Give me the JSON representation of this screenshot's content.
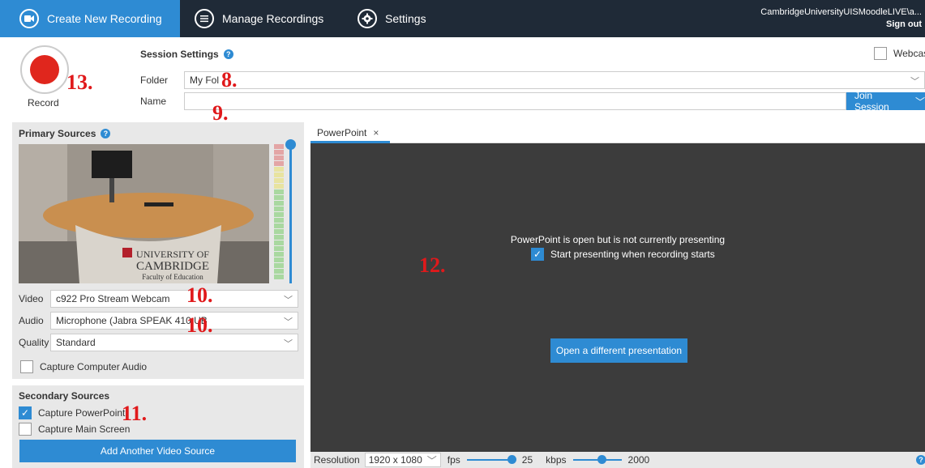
{
  "nav": {
    "tabs": [
      {
        "label": "Create New Recording",
        "icon": "video-camera-icon"
      },
      {
        "label": "Manage Recordings",
        "icon": "list-icon"
      },
      {
        "label": "Settings",
        "icon": "gear-icon"
      }
    ],
    "user": "CambridgeUniversityUISMoodleLIVE\\a...",
    "signout": "Sign out"
  },
  "record": {
    "label": "Record"
  },
  "session": {
    "title": "Session Settings",
    "folder_label": "Folder",
    "folder_value": "My Fol",
    "name_label": "Name",
    "name_value": "",
    "join_label": "Join Session",
    "webcast_label": "Webcast"
  },
  "annotations": {
    "a13": "13.",
    "a8": "8.",
    "a9": "9.",
    "a10a": "10.",
    "a10b": "10.",
    "a11": "11.",
    "a12": "12."
  },
  "primary": {
    "title": "Primary Sources",
    "video_label": "Video",
    "video_value": "c922 Pro Stream Webcam",
    "audio_label": "Audio",
    "audio_value": "Microphone (Jabra SPEAK 410 U",
    "audio_value_tail": "B",
    "quality_label": "Quality",
    "quality_value": "Standard",
    "capture_audio_label": "Capture Computer Audio",
    "capture_audio_checked": false,
    "preview_text_1": "UNIVERSITY OF",
    "preview_text_2": "CAMBRIDGE",
    "preview_text_3": "Faculty of Education"
  },
  "secondary": {
    "title": "Secondary Sources",
    "capture_ppt_label": "Capture PowerPoint",
    "capture_ppt_checked": true,
    "capture_screen_label": "Capture Main Screen",
    "capture_screen_checked": false,
    "add_source_label": "Add Another Video Source"
  },
  "presentation": {
    "tab_label": "PowerPoint",
    "tab_close": "×",
    "message": "PowerPoint is open but is not currently presenting",
    "start_label": "Start presenting when recording starts",
    "start_checked": true,
    "open_label": "Open a different presentation"
  },
  "status": {
    "resolution_label": "Resolution",
    "resolution_value": "1920 x 1080",
    "fps_label": "fps",
    "fps_value": "25",
    "kbps_label": "kbps",
    "kbps_value": "2000"
  },
  "colors": {
    "accent": "#2e8bd3",
    "nav_bg": "#1f2a37",
    "record_red": "#e0261d",
    "annotation_red": "#e0191b"
  }
}
